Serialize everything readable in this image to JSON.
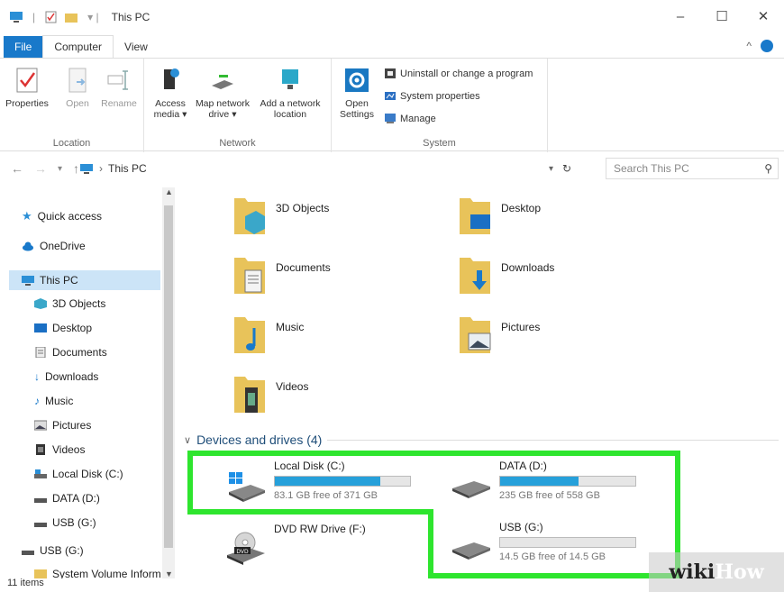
{
  "window": {
    "title": "This PC",
    "controls": [
      "–",
      "☐",
      "✕"
    ]
  },
  "ribbon_tabs": [
    "File",
    "Computer",
    "View"
  ],
  "ribbon": {
    "location": {
      "label": "Location",
      "buttons": [
        {
          "label": "Properties",
          "icon": "properties-icon"
        },
        {
          "label": "Open",
          "icon": "open-icon"
        },
        {
          "label": "Rename",
          "icon": "rename-icon"
        }
      ]
    },
    "network": {
      "label": "Network",
      "buttons": [
        {
          "label": "Access media ▾",
          "icon": "access-media-icon"
        },
        {
          "label": "Map network drive ▾",
          "icon": "map-network-drive-icon"
        },
        {
          "label": "Add a network location",
          "icon": "add-network-location-icon"
        }
      ]
    },
    "system": {
      "label": "System",
      "open_settings": "Open Settings",
      "items": [
        "Uninstall or change a program",
        "System properties",
        "Manage"
      ]
    }
  },
  "address": {
    "path": "This PC",
    "search_placeholder": "Search This PC"
  },
  "sidebar": {
    "items": [
      {
        "label": "Quick access",
        "icon": "star-icon"
      },
      {
        "label": "OneDrive",
        "icon": "cloud-icon"
      },
      {
        "label": "This PC",
        "icon": "monitor-icon"
      },
      {
        "label": "3D Objects",
        "icon": "cube-icon"
      },
      {
        "label": "Desktop",
        "icon": "desktop-icon"
      },
      {
        "label": "Documents",
        "icon": "document-icon"
      },
      {
        "label": "Downloads",
        "icon": "download-arrow-icon"
      },
      {
        "label": "Music",
        "icon": "music-note-icon"
      },
      {
        "label": "Pictures",
        "icon": "picture-icon"
      },
      {
        "label": "Videos",
        "icon": "film-icon"
      },
      {
        "label": "Local Disk (C:)",
        "icon": "drive-icon"
      },
      {
        "label": "DATA (D:)",
        "icon": "drive-icon"
      },
      {
        "label": "USB (G:)",
        "icon": "drive-icon"
      },
      {
        "label": "USB (G:)",
        "icon": "drive-icon"
      },
      {
        "label": "System Volume Inform",
        "icon": "folder-icon"
      }
    ]
  },
  "folders": [
    {
      "label": "3D Objects",
      "icon": "3d-objects-folder-icon"
    },
    {
      "label": "Desktop",
      "icon": "desktop-folder-icon"
    },
    {
      "label": "Documents",
      "icon": "documents-folder-icon"
    },
    {
      "label": "Downloads",
      "icon": "downloads-folder-icon"
    },
    {
      "label": "Music",
      "icon": "music-folder-icon"
    },
    {
      "label": "Pictures",
      "icon": "pictures-folder-icon"
    },
    {
      "label": "Videos",
      "icon": "videos-folder-icon"
    }
  ],
  "devices_section": "Devices and drives (4)",
  "drives": [
    {
      "name": "Local Disk (C:)",
      "free": "83.1 GB free of 371 GB",
      "used_fraction": 0.78
    },
    {
      "name": "DATA (D:)",
      "free": "235 GB free of 558 GB",
      "used_fraction": 0.58
    },
    {
      "name": "USB (G:)",
      "free": "14.5 GB free of 14.5 GB",
      "used_fraction": 0.0
    },
    {
      "name": "DVD RW Drive (F:)",
      "free": ""
    }
  ],
  "status": "11 items",
  "watermark": {
    "a": "wiki",
    "b": "How"
  },
  "colors": {
    "accent": "#1979ca",
    "bar": "#26a0da",
    "highlight": "#2ee52e"
  }
}
